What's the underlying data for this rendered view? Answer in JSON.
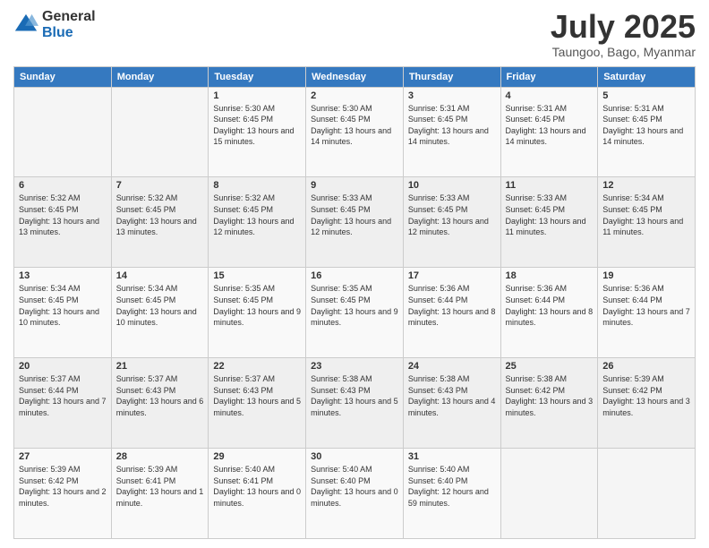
{
  "logo": {
    "general": "General",
    "blue": "Blue"
  },
  "title": "July 2025",
  "subtitle": "Taungoo, Bago, Myanmar",
  "days_of_week": [
    "Sunday",
    "Monday",
    "Tuesday",
    "Wednesday",
    "Thursday",
    "Friday",
    "Saturday"
  ],
  "weeks": [
    [
      {
        "day": "",
        "info": ""
      },
      {
        "day": "",
        "info": ""
      },
      {
        "day": "1",
        "info": "Sunrise: 5:30 AM\nSunset: 6:45 PM\nDaylight: 13 hours and 15 minutes."
      },
      {
        "day": "2",
        "info": "Sunrise: 5:30 AM\nSunset: 6:45 PM\nDaylight: 13 hours and 14 minutes."
      },
      {
        "day": "3",
        "info": "Sunrise: 5:31 AM\nSunset: 6:45 PM\nDaylight: 13 hours and 14 minutes."
      },
      {
        "day": "4",
        "info": "Sunrise: 5:31 AM\nSunset: 6:45 PM\nDaylight: 13 hours and 14 minutes."
      },
      {
        "day": "5",
        "info": "Sunrise: 5:31 AM\nSunset: 6:45 PM\nDaylight: 13 hours and 14 minutes."
      }
    ],
    [
      {
        "day": "6",
        "info": "Sunrise: 5:32 AM\nSunset: 6:45 PM\nDaylight: 13 hours and 13 minutes."
      },
      {
        "day": "7",
        "info": "Sunrise: 5:32 AM\nSunset: 6:45 PM\nDaylight: 13 hours and 13 minutes."
      },
      {
        "day": "8",
        "info": "Sunrise: 5:32 AM\nSunset: 6:45 PM\nDaylight: 13 hours and 12 minutes."
      },
      {
        "day": "9",
        "info": "Sunrise: 5:33 AM\nSunset: 6:45 PM\nDaylight: 13 hours and 12 minutes."
      },
      {
        "day": "10",
        "info": "Sunrise: 5:33 AM\nSunset: 6:45 PM\nDaylight: 13 hours and 12 minutes."
      },
      {
        "day": "11",
        "info": "Sunrise: 5:33 AM\nSunset: 6:45 PM\nDaylight: 13 hours and 11 minutes."
      },
      {
        "day": "12",
        "info": "Sunrise: 5:34 AM\nSunset: 6:45 PM\nDaylight: 13 hours and 11 minutes."
      }
    ],
    [
      {
        "day": "13",
        "info": "Sunrise: 5:34 AM\nSunset: 6:45 PM\nDaylight: 13 hours and 10 minutes."
      },
      {
        "day": "14",
        "info": "Sunrise: 5:34 AM\nSunset: 6:45 PM\nDaylight: 13 hours and 10 minutes."
      },
      {
        "day": "15",
        "info": "Sunrise: 5:35 AM\nSunset: 6:45 PM\nDaylight: 13 hours and 9 minutes."
      },
      {
        "day": "16",
        "info": "Sunrise: 5:35 AM\nSunset: 6:45 PM\nDaylight: 13 hours and 9 minutes."
      },
      {
        "day": "17",
        "info": "Sunrise: 5:36 AM\nSunset: 6:44 PM\nDaylight: 13 hours and 8 minutes."
      },
      {
        "day": "18",
        "info": "Sunrise: 5:36 AM\nSunset: 6:44 PM\nDaylight: 13 hours and 8 minutes."
      },
      {
        "day": "19",
        "info": "Sunrise: 5:36 AM\nSunset: 6:44 PM\nDaylight: 13 hours and 7 minutes."
      }
    ],
    [
      {
        "day": "20",
        "info": "Sunrise: 5:37 AM\nSunset: 6:44 PM\nDaylight: 13 hours and 7 minutes."
      },
      {
        "day": "21",
        "info": "Sunrise: 5:37 AM\nSunset: 6:43 PM\nDaylight: 13 hours and 6 minutes."
      },
      {
        "day": "22",
        "info": "Sunrise: 5:37 AM\nSunset: 6:43 PM\nDaylight: 13 hours and 5 minutes."
      },
      {
        "day": "23",
        "info": "Sunrise: 5:38 AM\nSunset: 6:43 PM\nDaylight: 13 hours and 5 minutes."
      },
      {
        "day": "24",
        "info": "Sunrise: 5:38 AM\nSunset: 6:43 PM\nDaylight: 13 hours and 4 minutes."
      },
      {
        "day": "25",
        "info": "Sunrise: 5:38 AM\nSunset: 6:42 PM\nDaylight: 13 hours and 3 minutes."
      },
      {
        "day": "26",
        "info": "Sunrise: 5:39 AM\nSunset: 6:42 PM\nDaylight: 13 hours and 3 minutes."
      }
    ],
    [
      {
        "day": "27",
        "info": "Sunrise: 5:39 AM\nSunset: 6:42 PM\nDaylight: 13 hours and 2 minutes."
      },
      {
        "day": "28",
        "info": "Sunrise: 5:39 AM\nSunset: 6:41 PM\nDaylight: 13 hours and 1 minute."
      },
      {
        "day": "29",
        "info": "Sunrise: 5:40 AM\nSunset: 6:41 PM\nDaylight: 13 hours and 0 minutes."
      },
      {
        "day": "30",
        "info": "Sunrise: 5:40 AM\nSunset: 6:40 PM\nDaylight: 13 hours and 0 minutes."
      },
      {
        "day": "31",
        "info": "Sunrise: 5:40 AM\nSunset: 6:40 PM\nDaylight: 12 hours and 59 minutes."
      },
      {
        "day": "",
        "info": ""
      },
      {
        "day": "",
        "info": ""
      }
    ]
  ]
}
